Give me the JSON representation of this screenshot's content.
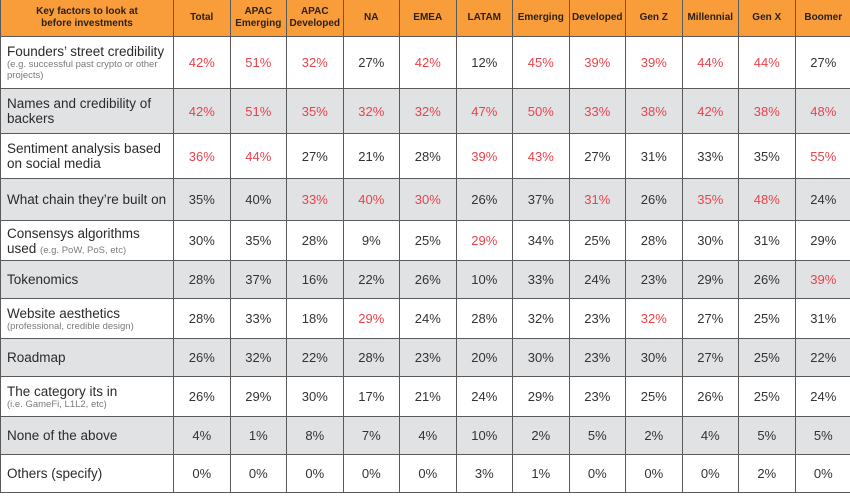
{
  "table": {
    "header": [
      "Key factors to look at before investments",
      "Total",
      "APAC Emerging",
      "APAC Developed",
      "NA",
      "EMEA",
      "LATAM",
      "Emerging",
      "Developed",
      "Gen Z",
      "Millennial",
      "Gen X",
      "Boomer"
    ],
    "header_lines": [
      [
        "Key factors to look at",
        "before investments"
      ],
      [
        "Total"
      ],
      [
        "APAC",
        "Emerging"
      ],
      [
        "APAC",
        "Developed"
      ],
      [
        "NA"
      ],
      [
        "EMEA"
      ],
      [
        "LATAM"
      ],
      [
        "Emerging"
      ],
      [
        "Developed"
      ],
      [
        "Gen Z"
      ],
      [
        "Millennial"
      ],
      [
        "Gen X"
      ],
      [
        "Boomer"
      ]
    ],
    "highlight_color": "#E8434B",
    "header_color": "#F99D3A",
    "shaded_row_color": "#E1E2E4",
    "rows": [
      {
        "factor": "Founders’ street credibility",
        "note": "(e.g. successful past crypto or other projects)",
        "values": [
          "42%",
          "51%",
          "32%",
          "27%",
          "42%",
          "12%",
          "45%",
          "39%",
          "39%",
          "44%",
          "44%",
          "27%"
        ],
        "highlighted": [
          true,
          true,
          true,
          false,
          true,
          false,
          true,
          true,
          true,
          true,
          true,
          false
        ]
      },
      {
        "factor": "Names and credibility of backers",
        "note": "",
        "values": [
          "42%",
          "51%",
          "35%",
          "32%",
          "32%",
          "47%",
          "50%",
          "33%",
          "38%",
          "42%",
          "38%",
          "48%"
        ],
        "highlighted": [
          true,
          true,
          true,
          true,
          true,
          true,
          true,
          true,
          true,
          true,
          true,
          true
        ]
      },
      {
        "factor": "Sentiment analysis based on social media",
        "note": "",
        "values": [
          "36%",
          "44%",
          "27%",
          "21%",
          "28%",
          "39%",
          "43%",
          "27%",
          "31%",
          "33%",
          "35%",
          "55%"
        ],
        "highlighted": [
          true,
          true,
          false,
          false,
          false,
          true,
          true,
          false,
          false,
          false,
          false,
          true
        ]
      },
      {
        "factor": "What chain they’re built on",
        "note": "",
        "values": [
          "35%",
          "40%",
          "33%",
          "40%",
          "30%",
          "26%",
          "37%",
          "31%",
          "26%",
          "35%",
          "48%",
          "24%"
        ],
        "highlighted": [
          false,
          false,
          true,
          true,
          true,
          false,
          false,
          true,
          false,
          true,
          true,
          false
        ]
      },
      {
        "factor": "Consensys algorithms used",
        "note": "(e.g. PoW, PoS, etc)",
        "values": [
          "30%",
          "35%",
          "28%",
          "9%",
          "25%",
          "29%",
          "34%",
          "25%",
          "28%",
          "30%",
          "31%",
          "29%"
        ],
        "highlighted": [
          false,
          false,
          false,
          false,
          false,
          true,
          false,
          false,
          false,
          false,
          false,
          false
        ]
      },
      {
        "factor": "Tokenomics",
        "note": "",
        "values": [
          "28%",
          "37%",
          "16%",
          "22%",
          "26%",
          "10%",
          "33%",
          "24%",
          "23%",
          "29%",
          "26%",
          "39%"
        ],
        "highlighted": [
          false,
          false,
          false,
          false,
          false,
          false,
          false,
          false,
          false,
          false,
          false,
          true
        ]
      },
      {
        "factor": "Website aesthetics",
        "note": "(professional, credible design)",
        "values": [
          "28%",
          "33%",
          "18%",
          "29%",
          "24%",
          "28%",
          "32%",
          "23%",
          "32%",
          "27%",
          "25%",
          "31%"
        ],
        "highlighted": [
          false,
          false,
          false,
          true,
          false,
          false,
          false,
          false,
          true,
          false,
          false,
          false
        ]
      },
      {
        "factor": "Roadmap",
        "note": "",
        "values": [
          "26%",
          "32%",
          "22%",
          "28%",
          "23%",
          "20%",
          "30%",
          "23%",
          "30%",
          "27%",
          "25%",
          "22%"
        ],
        "highlighted": [
          false,
          false,
          false,
          false,
          false,
          false,
          false,
          false,
          false,
          false,
          false,
          false
        ]
      },
      {
        "factor": "The category its in",
        "note": "(i.e. GameFi, L1L2, etc)",
        "values": [
          "26%",
          "29%",
          "30%",
          "17%",
          "21%",
          "24%",
          "29%",
          "23%",
          "25%",
          "26%",
          "25%",
          "24%"
        ],
        "highlighted": [
          false,
          false,
          false,
          false,
          false,
          false,
          false,
          false,
          false,
          false,
          false,
          false
        ]
      },
      {
        "factor": "None of the above",
        "note": "",
        "values": [
          "4%",
          "1%",
          "8%",
          "7%",
          "4%",
          "10%",
          "2%",
          "5%",
          "2%",
          "4%",
          "5%",
          "5%"
        ],
        "highlighted": [
          false,
          false,
          false,
          false,
          false,
          false,
          false,
          false,
          false,
          false,
          false,
          false
        ]
      },
      {
        "factor": "Others (specify)",
        "note": "",
        "values": [
          "0%",
          "0%",
          "0%",
          "0%",
          "0%",
          "3%",
          "1%",
          "0%",
          "0%",
          "0%",
          "2%",
          "0%"
        ],
        "highlighted": [
          false,
          false,
          false,
          false,
          false,
          false,
          false,
          false,
          false,
          false,
          false,
          false
        ]
      }
    ]
  }
}
